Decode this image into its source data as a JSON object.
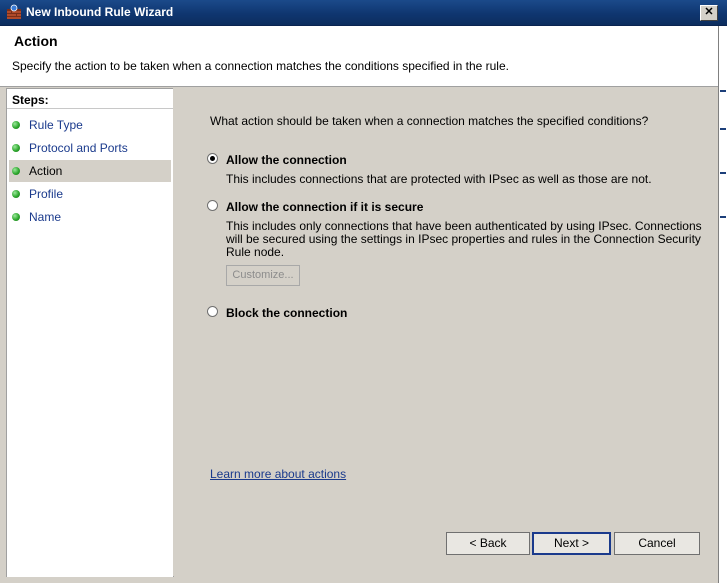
{
  "window": {
    "title": "New Inbound Rule Wizard",
    "close_glyph": "✕"
  },
  "header": {
    "title": "Action",
    "subtitle": "Specify the action to be taken when a connection matches the conditions specified in the rule."
  },
  "steps": {
    "label": "Steps:",
    "items": [
      {
        "label": "Rule Type",
        "active": false
      },
      {
        "label": "Protocol and Ports",
        "active": false
      },
      {
        "label": "Action",
        "active": true
      },
      {
        "label": "Profile",
        "active": false
      },
      {
        "label": "Name",
        "active": false
      }
    ]
  },
  "main": {
    "question": "What action should be taken when a connection matches the specified conditions?",
    "options": [
      {
        "label": "Allow the connection",
        "description": "This includes connections that are protected with IPsec as well as those are not.",
        "selected": true
      },
      {
        "label": "Allow the connection if it is secure",
        "description_lines": [
          "This includes only connections that have been authenticated by using IPsec.  Connections",
          "will be secured using the settings in IPsec properties and rules in the Connection Security",
          "Rule node."
        ],
        "selected": false
      },
      {
        "label": "Block the connection",
        "selected": false
      }
    ],
    "customize_label": "Customize...",
    "learn_more": "Learn more about actions"
  },
  "footer": {
    "back_label": "< Back",
    "next_label": "Next >",
    "cancel_label": "Cancel"
  },
  "colors": {
    "titlebar": "#0f3670",
    "link": "#1a3a8c",
    "step_dot": "#2ea82e",
    "panel_bg": "#d4d0c8"
  }
}
